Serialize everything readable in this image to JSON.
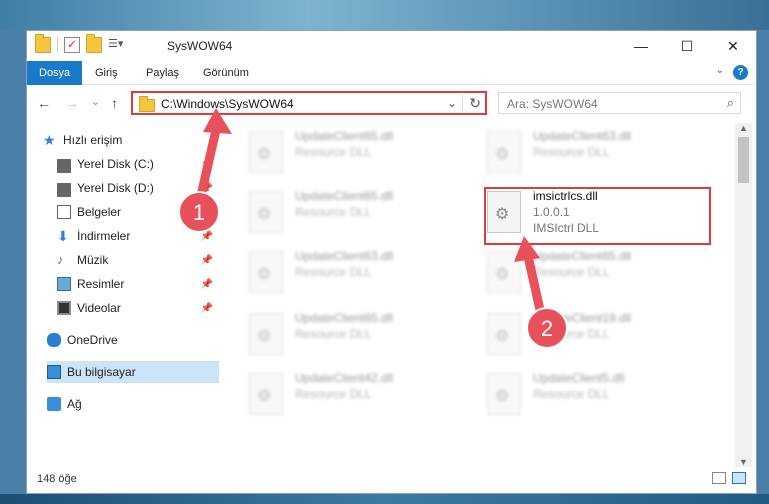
{
  "window": {
    "title": "SysWOW64",
    "minimize": "—",
    "maximize": "☐",
    "close": "✕"
  },
  "ribbon": {
    "tabs": [
      "Dosya",
      "Giriş",
      "Paylaş",
      "Görünüm"
    ],
    "help": "?"
  },
  "navigation": {
    "back": "←",
    "forward": "→",
    "recent": "⌄",
    "up": "↑",
    "address": "C:\\Windows\\SysWOW64",
    "dropdown": "⌄",
    "refresh": "↻",
    "search_placeholder": "Ara: SysWOW64",
    "search_icon": "⌕"
  },
  "sidebar": {
    "items": [
      {
        "label": "Hızlı erişim",
        "icon": "star-icon"
      },
      {
        "label": "Yerel Disk (C:)",
        "icon": "drive-icon",
        "pinned": true
      },
      {
        "label": "Yerel Disk (D:)",
        "icon": "drive-icon",
        "pinned": true
      },
      {
        "label": "Belgeler",
        "icon": "document-icon",
        "pinned": true
      },
      {
        "label": "İndirmeler",
        "icon": "download-icon",
        "pinned": true
      },
      {
        "label": "Müzik",
        "icon": "music-icon",
        "pinned": true
      },
      {
        "label": "Resimler",
        "icon": "pictures-icon",
        "pinned": true
      },
      {
        "label": "Videolar",
        "icon": "video-icon",
        "pinned": true
      },
      {
        "label": "OneDrive",
        "icon": "cloud-icon"
      },
      {
        "label": "Bu bilgisayar",
        "icon": "computer-icon",
        "selected": true
      },
      {
        "label": "Ağ",
        "icon": "network-icon"
      }
    ]
  },
  "files": [
    {
      "name": "UpdateClient65.dll",
      "desc": "Resource DLL"
    },
    {
      "name": "UpdateClient63.dll",
      "desc": "Resource DLL"
    },
    {
      "name": "UpdateClient65.dll",
      "desc": "Resource DLL"
    },
    {
      "name": "imsictrlcs.dll",
      "version": "1.0.0.1",
      "desc": "IMSIctrl DLL",
      "highlighted": true
    },
    {
      "name": "UpdateClient63.dll",
      "desc": "Resource DLL"
    },
    {
      "name": "UpdateClient65.dll",
      "desc": "Resource DLL"
    },
    {
      "name": "UpdateClient65.dll",
      "desc": "Resource DLL"
    },
    {
      "name": "UpdateClient19.dll",
      "desc": "Resource DLL"
    },
    {
      "name": "UpdateClient42.dll",
      "desc": "Resource DLL"
    },
    {
      "name": "UpdateClient5.dll",
      "desc": "Resource DLL"
    }
  ],
  "annotations": {
    "step1": "1",
    "step2": "2",
    "accent": "#e03c3c"
  },
  "status": {
    "count": "148 öğe"
  }
}
